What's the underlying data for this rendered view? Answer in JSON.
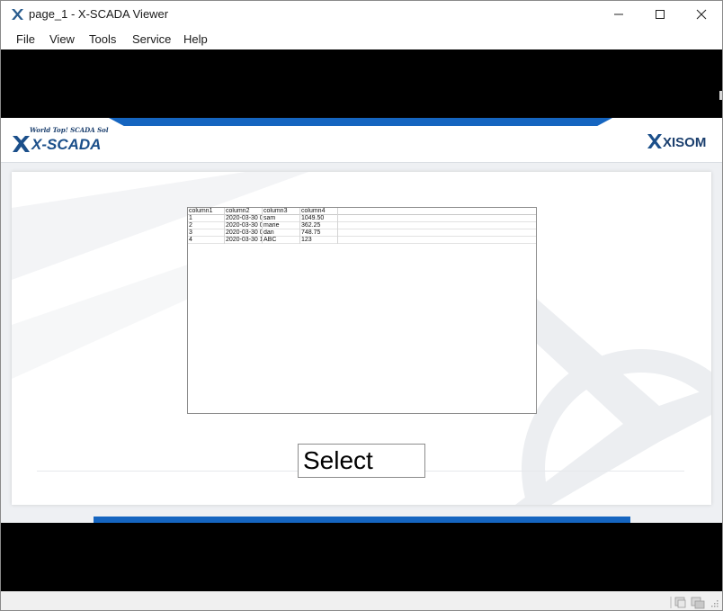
{
  "window": {
    "title": "page_1 - X-SCADA Viewer",
    "app_icon": "x-scada-app-icon",
    "controls": [
      "minimize-icon",
      "maximize-icon",
      "close-icon"
    ]
  },
  "menu": {
    "items": [
      {
        "label": "File"
      },
      {
        "label": "View"
      },
      {
        "label": "Tools"
      },
      {
        "label": "Service"
      },
      {
        "label": "Help"
      }
    ]
  },
  "header": {
    "logo_left": {
      "tagline": "World Top! SCADA Solution",
      "name": "X-SCADA"
    },
    "logo_right": {
      "name": "XISOM"
    },
    "accent_color": "#1565c0"
  },
  "grid": {
    "columns": [
      "column1",
      "column2",
      "column3",
      "column4"
    ],
    "rows": [
      [
        "1",
        "2020-03-30 0",
        "sam",
        "1049.50"
      ],
      [
        "2",
        "2020-03-30 0",
        "marie",
        "362.25"
      ],
      [
        "3",
        "2020-03-30 0",
        "dan",
        "748.75"
      ],
      [
        "4",
        "2020-03-30 1",
        "ABC",
        "123"
      ]
    ]
  },
  "select_button": {
    "label": "Select"
  },
  "status_bar": {
    "icons": [
      "grid-view-icon",
      "windows-icon",
      "resize-grip-icon"
    ]
  }
}
